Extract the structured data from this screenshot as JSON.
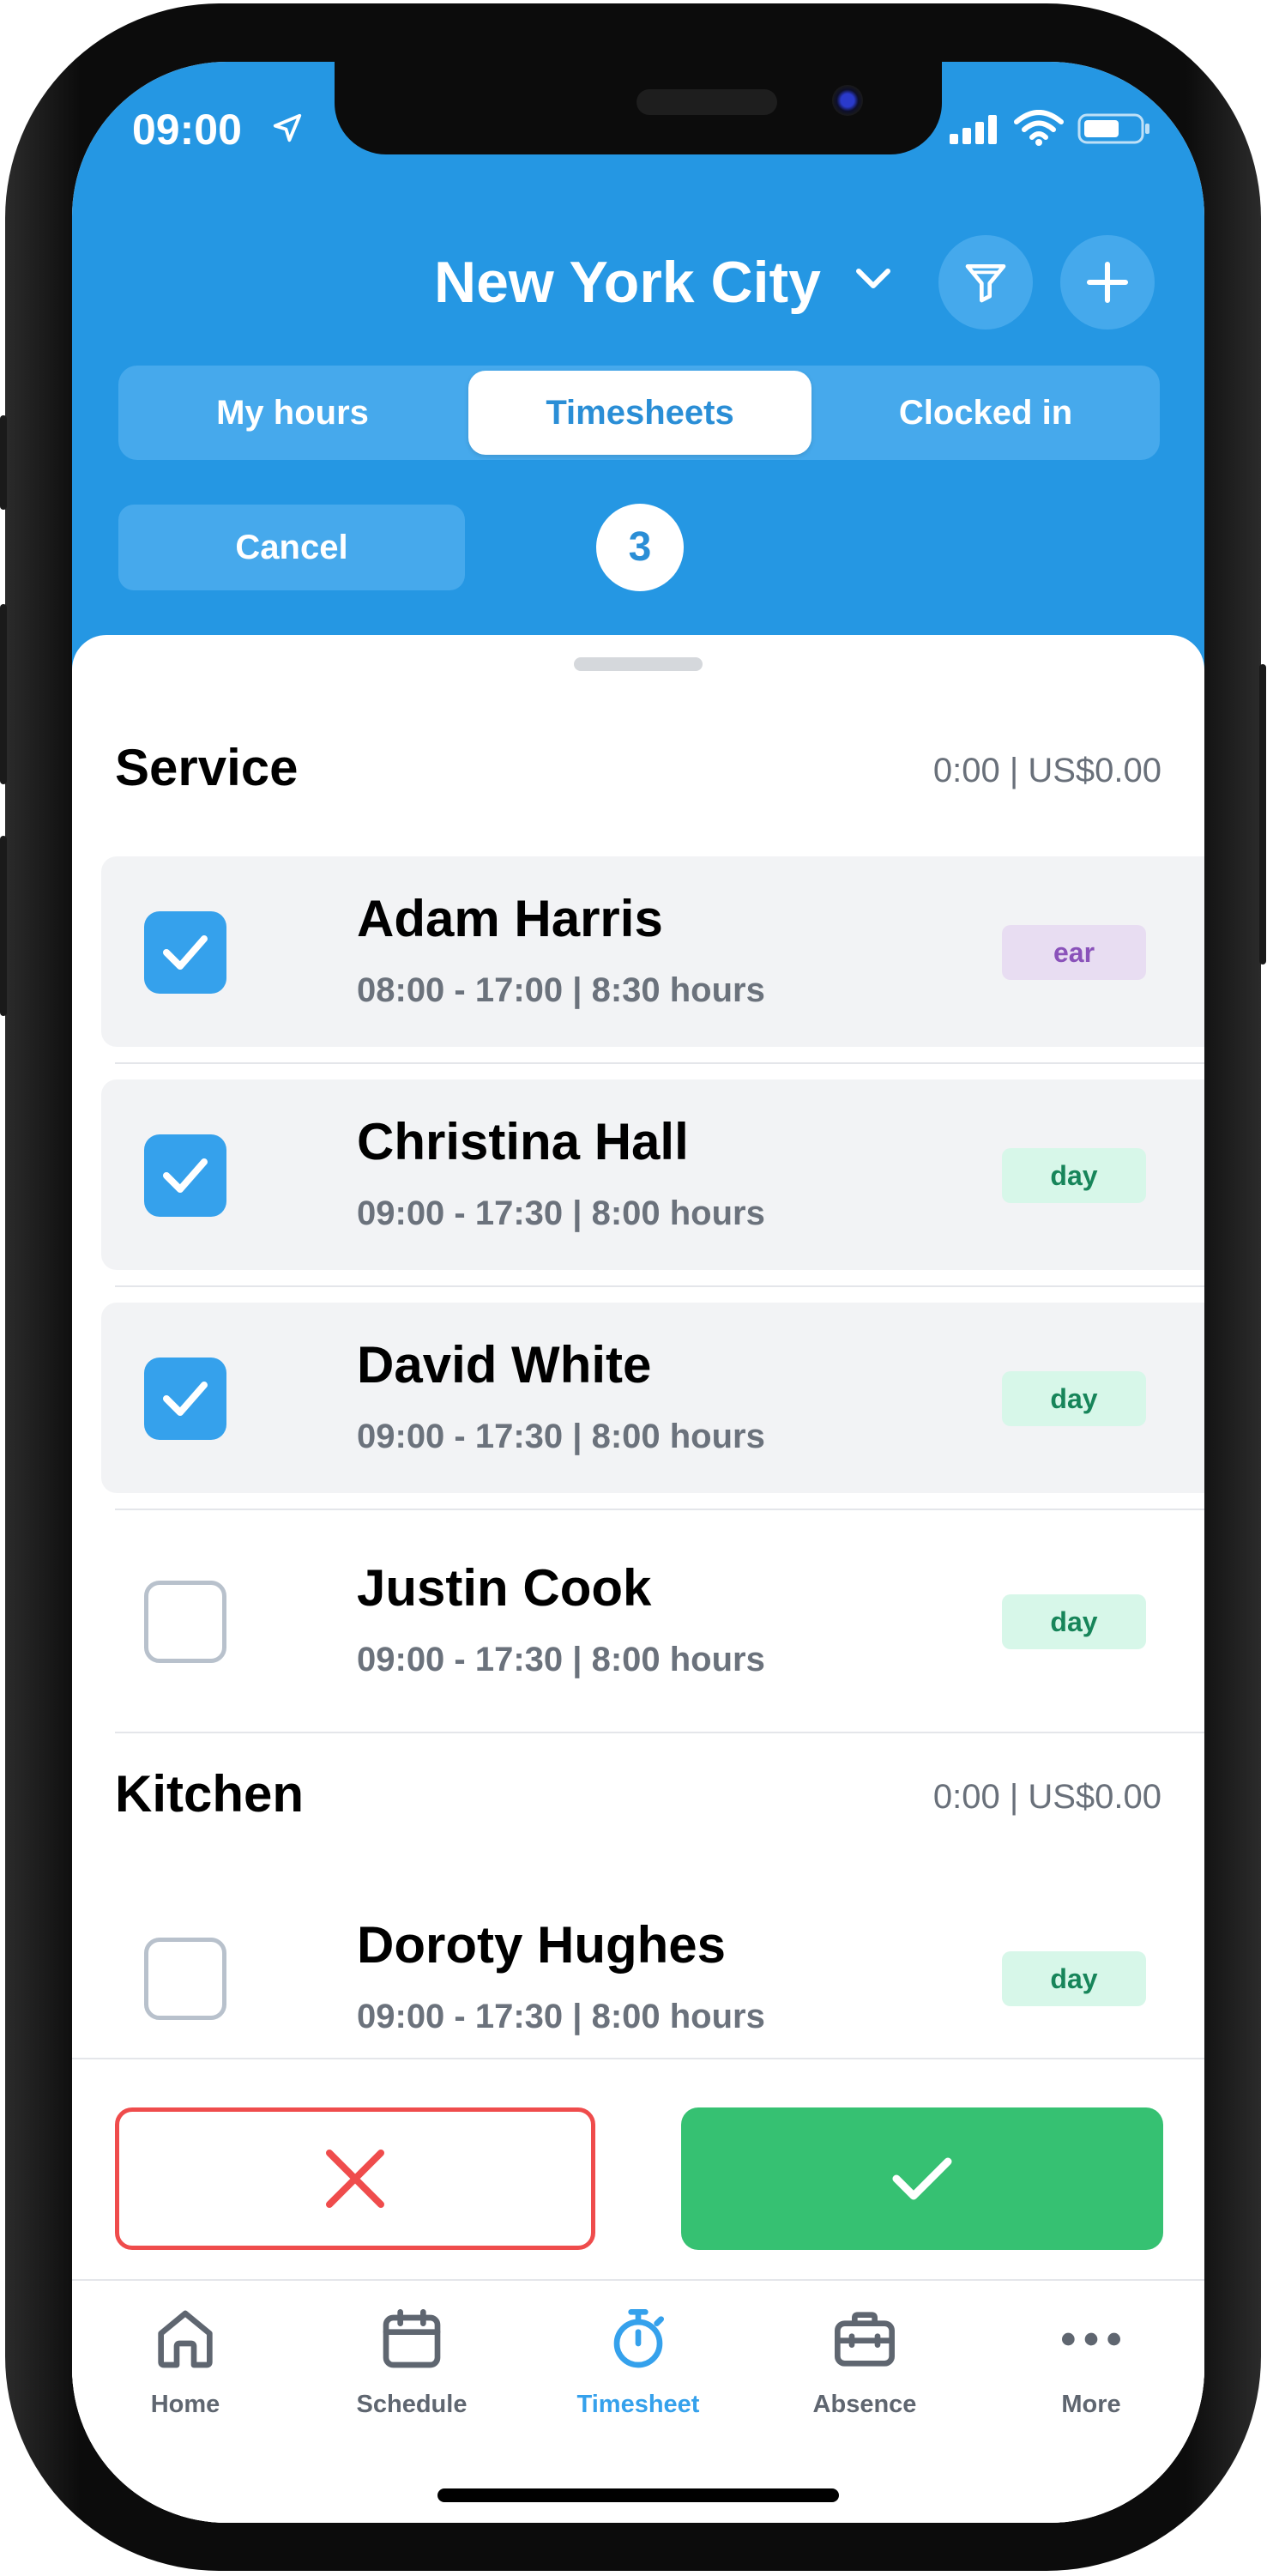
{
  "status": {
    "time": "09:00"
  },
  "header": {
    "location": "New York City"
  },
  "segments": [
    {
      "label": "My hours"
    },
    {
      "label": "Timesheets"
    },
    {
      "label": "Clocked in"
    }
  ],
  "selection": {
    "cancel_label": "Cancel",
    "count": "3"
  },
  "sections": [
    {
      "title": "Service",
      "summary": "0:00 | US$0.00",
      "rows": [
        {
          "name": "Adam Harris",
          "hours": "08:00 - 17:00 | 8:30 hours",
          "tag": "ear",
          "checked": true
        },
        {
          "name": "Christina Hall",
          "hours": "09:00 - 17:30 | 8:00 hours",
          "tag": "day",
          "checked": true
        },
        {
          "name": "David White",
          "hours": "09:00 - 17:30 | 8:00 hours",
          "tag": "day",
          "checked": true
        },
        {
          "name": "Justin Cook",
          "hours": "09:00 - 17:30 | 8:00 hours",
          "tag": "day",
          "checked": false
        }
      ]
    },
    {
      "title": "Kitchen",
      "summary": "0:00 | US$0.00",
      "rows": [
        {
          "name": "Doroty Hughes",
          "hours": "09:00 - 17:30 | 8:00 hours",
          "tag": "day",
          "checked": false
        }
      ]
    }
  ],
  "tabbar": [
    {
      "label": "Home",
      "icon": "home-icon"
    },
    {
      "label": "Schedule",
      "icon": "calendar-icon"
    },
    {
      "label": "Timesheet",
      "icon": "stopwatch-icon"
    },
    {
      "label": "Absence",
      "icon": "briefcase-icon"
    },
    {
      "label": "More",
      "icon": "more-dots-icon"
    }
  ],
  "colors": {
    "header_blue": "#2597e3",
    "checkbox_blue": "#35a1ec",
    "approve_green": "#36c172",
    "reject_red": "#ef4c4c",
    "tag_purple_bg": "#e8ddf2",
    "tag_green_bg": "#d7f7e9"
  }
}
